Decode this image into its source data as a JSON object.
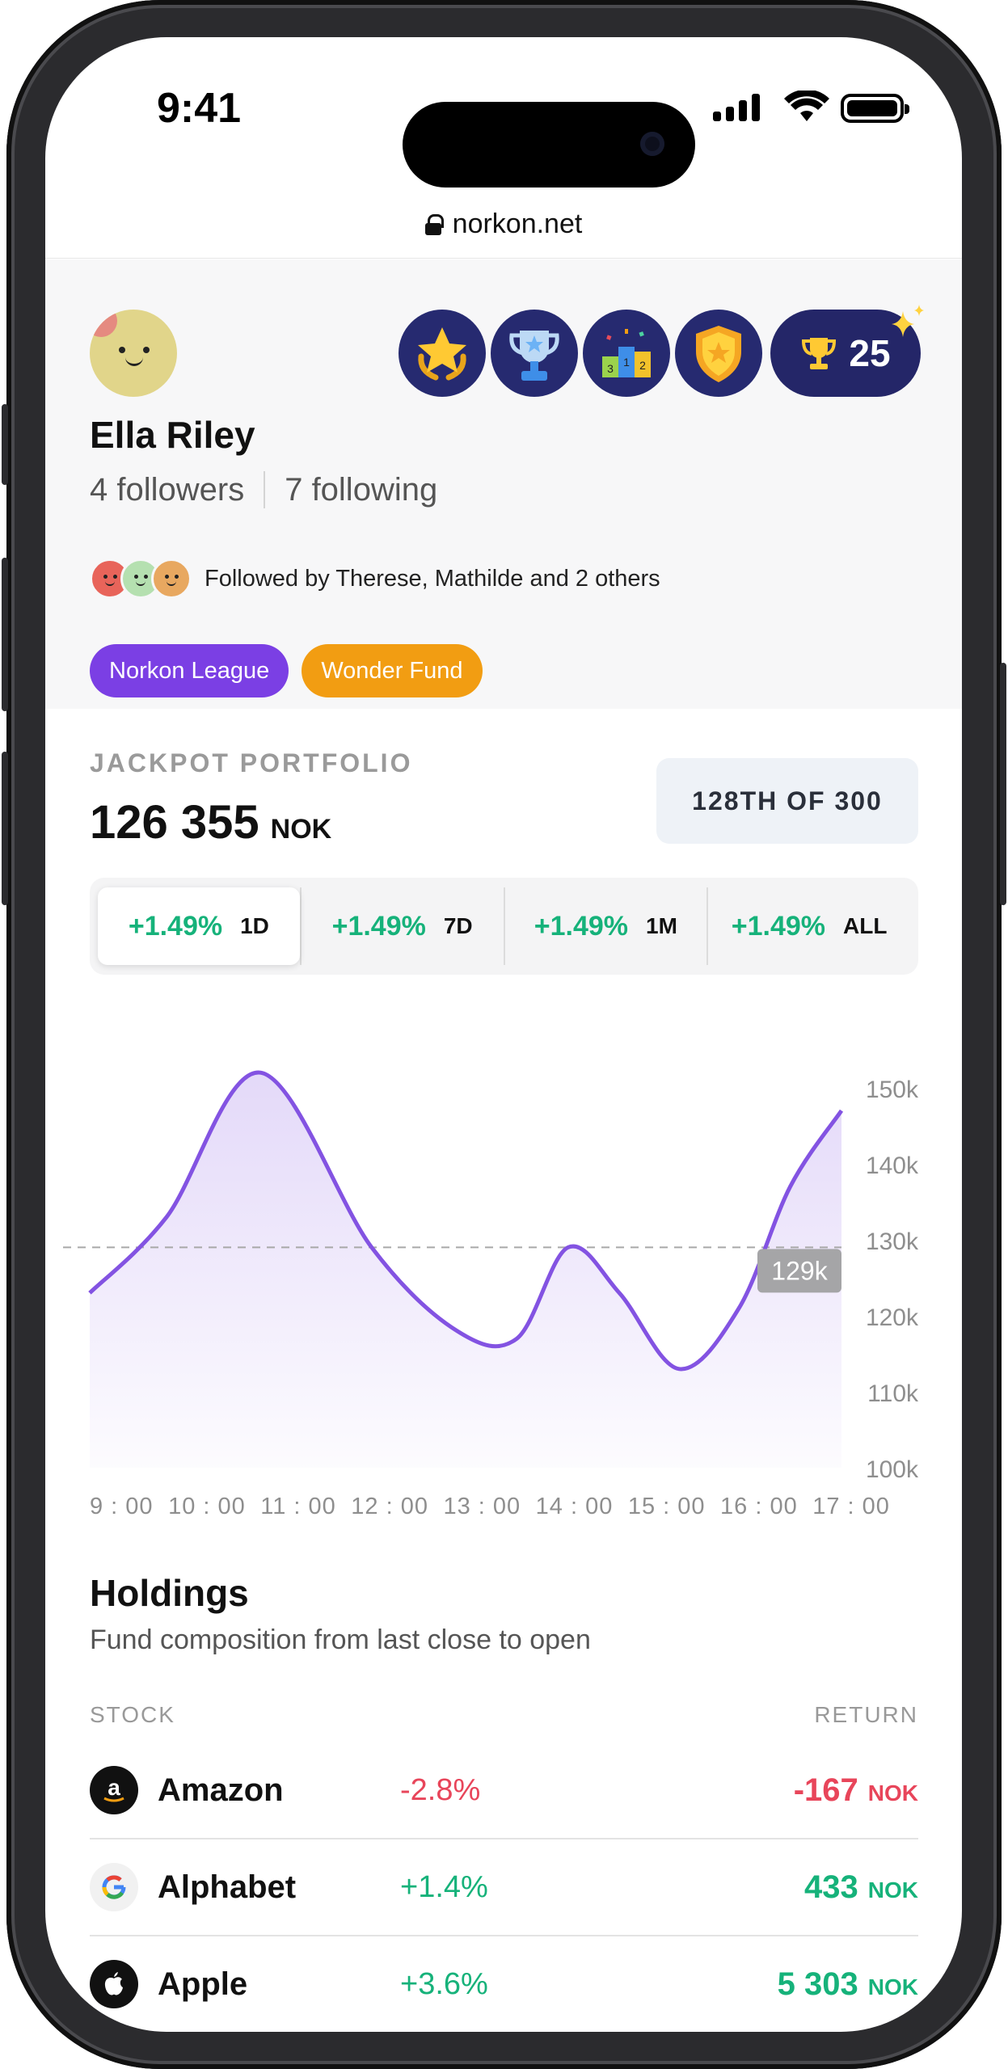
{
  "status_bar": {
    "time": "9:41"
  },
  "browser": {
    "url": "norkon.net"
  },
  "profile": {
    "name": "Ella Riley",
    "followers": "4 followers",
    "following": "7 following",
    "followed_by": "Followed by Therese, Mathilde and 2 others",
    "trophy_count": "25",
    "badges": [
      "star-laurel-badge",
      "trophy-cup-badge",
      "podium-badge",
      "shield-star-badge"
    ],
    "tags": [
      "Norkon League",
      "Wonder Fund"
    ]
  },
  "portfolio": {
    "label": "JACKPOT PORTFOLIO",
    "value": "126 355",
    "currency": "NOK",
    "rank": "128TH OF 300",
    "periods": [
      {
        "change": "+1.49%",
        "label": "1D",
        "active": true
      },
      {
        "change": "+1.49%",
        "label": "7D",
        "active": false
      },
      {
        "change": "+1.49%",
        "label": "1M",
        "active": false
      },
      {
        "change": "+1.49%",
        "label": "ALL",
        "active": false
      }
    ]
  },
  "chart_data": {
    "type": "area",
    "x": [
      "9 : 00",
      "10 : 00",
      "11 : 00",
      "12 : 00",
      "13 : 00",
      "14 : 00",
      "15 : 00",
      "16 : 00",
      "17 : 00"
    ],
    "y_ticks": [
      "150k",
      "140k",
      "140k",
      "130k",
      "120k",
      "110k",
      "100k"
    ],
    "y_tick_labels": [
      "150k",
      "140k",
      "130k",
      "120k",
      "110k",
      "100k"
    ],
    "ylim": [
      100,
      150
    ],
    "points": [
      [
        0.0,
        123
      ],
      [
        0.9,
        133
      ],
      [
        2.0,
        152
      ],
      [
        3.3,
        129
      ],
      [
        4.3,
        118
      ],
      [
        5.0,
        117
      ],
      [
        5.6,
        129
      ],
      [
        6.2,
        123
      ],
      [
        6.9,
        113
      ],
      [
        7.6,
        121
      ],
      [
        8.2,
        137
      ],
      [
        8.8,
        147
      ]
    ],
    "reference_line": 129,
    "reference_label": "129k",
    "line_color": "#8353e2"
  },
  "holdings": {
    "title": "Holdings",
    "subtitle": "Fund composition from last close to open",
    "col_stock": "STOCK",
    "col_return": "RETURN",
    "rows": [
      {
        "name": "Amazon",
        "change": "-2.8%",
        "value": "-167",
        "currency": "NOK",
        "trend": "neg",
        "icon": "amazon-logo-icon"
      },
      {
        "name": "Alphabet",
        "change": "+1.4%",
        "value": "433",
        "currency": "NOK",
        "trend": "pos",
        "icon": "google-logo-icon"
      },
      {
        "name": "Apple",
        "change": "+3.6%",
        "value": "5 303",
        "currency": "NOK",
        "trend": "pos",
        "icon": "apple-logo-icon"
      }
    ]
  }
}
